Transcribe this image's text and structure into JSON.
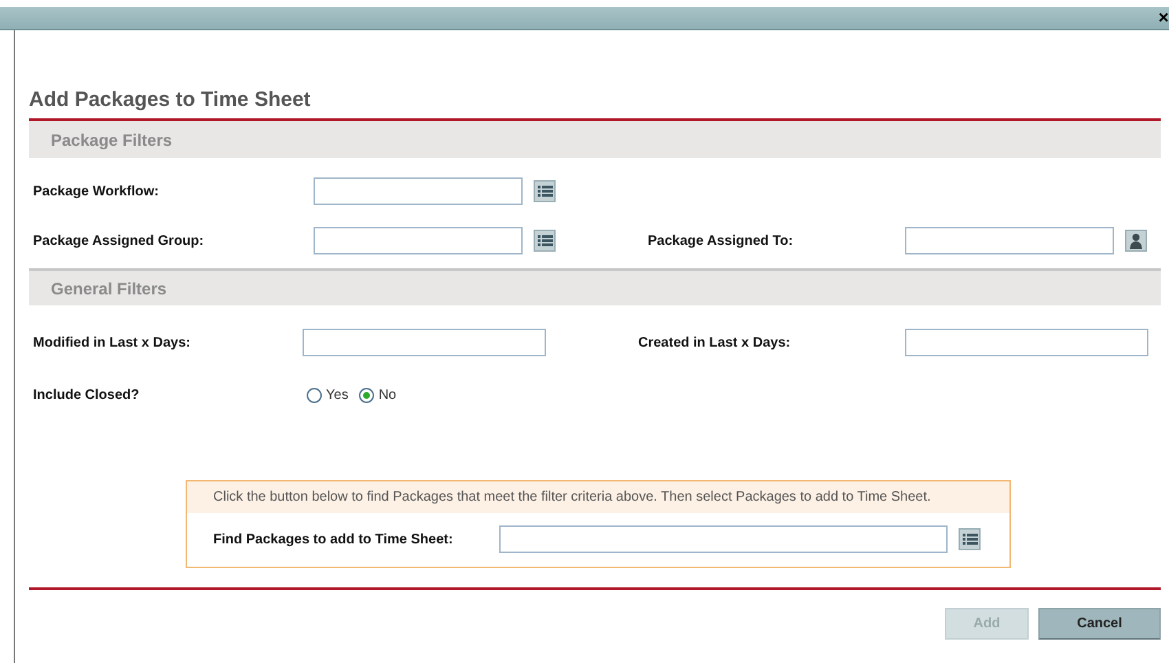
{
  "window": {
    "close": "×"
  },
  "title": "Add Packages to Time Sheet",
  "sections": [
    {
      "kind": "package",
      "title": "Package Filters",
      "rows": [
        {
          "cells": [
            {
              "label": "Package Workflow:",
              "kind": "text",
              "picker": {
                "kind": "list"
              }
            }
          ]
        },
        {
          "cells": [
            {
              "label": "Package Assigned Group:",
              "kind": "text",
              "picker": {
                "kind": "list"
              }
            },
            {
              "label": "Package Assigned To:",
              "kind": "text",
              "picker": {
                "kind": "person"
              }
            }
          ]
        }
      ]
    },
    {
      "kind": "general",
      "title": "General Filters",
      "rows": [
        {
          "cells": [
            {
              "label": "Modified in Last x Days:",
              "kind": "text"
            },
            {
              "label": "Created in Last x Days:",
              "kind": "text"
            }
          ]
        },
        {
          "cells": [
            {
              "label": "Include Closed?",
              "kind": "radio",
              "options": [
                {
                  "label": "Yes",
                  "selected": false
                },
                {
                  "label": "No",
                  "selected": true
                }
              ]
            }
          ]
        }
      ]
    }
  ],
  "finder": {
    "hint": "Click the button below to find Packages that meet the filter criteria above. Then select Packages to add to Time Sheet.",
    "label": "Find Packages to add to Time Sheet:",
    "picker": {
      "kind": "list"
    }
  },
  "buttons": [
    {
      "label": "Add",
      "disabled": true
    },
    {
      "label": "Cancel",
      "disabled": false
    }
  ]
}
